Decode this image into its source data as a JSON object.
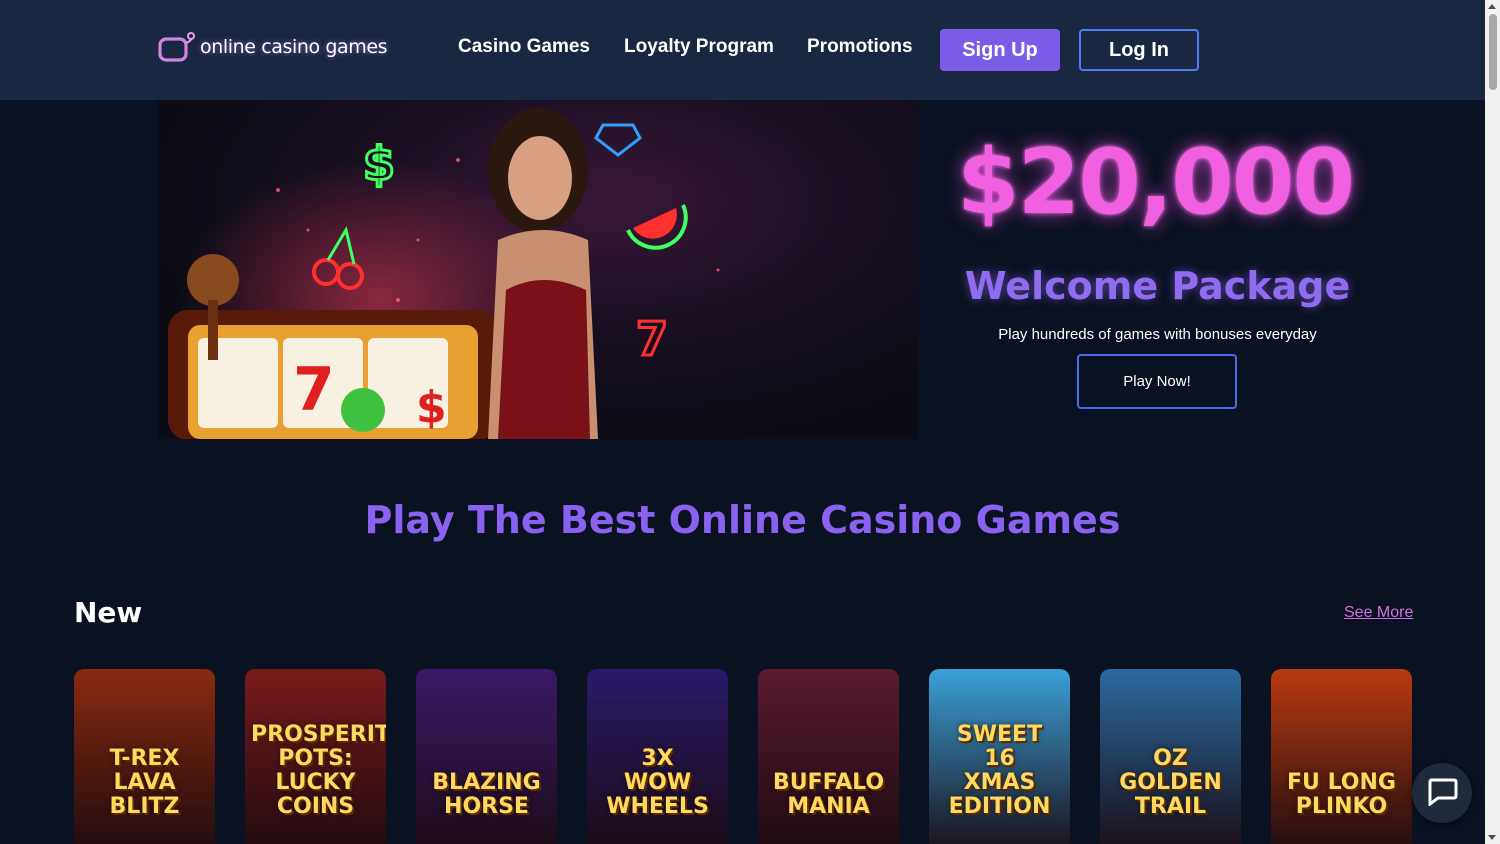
{
  "header": {
    "logo_text": "online casino games",
    "nav": [
      "Casino Games",
      "Loyalty Program",
      "Promotions"
    ],
    "signup_label": "Sign Up",
    "login_label": "Log In"
  },
  "hero": {
    "amount": "$20,000",
    "subtitle": "Welcome Package",
    "description": "Play hundreds of games with bonuses everyday",
    "cta_label": "Play Now!"
  },
  "section_title": "Play The Best Online Casino Games",
  "new_section": {
    "label": "New",
    "see_more": "See More",
    "games": [
      {
        "name": "T-REX\nLAVA BLITZ",
        "bg": "#8a2a10"
      },
      {
        "name": "PROSPERITY\nPOTS:\nLUCKY COINS",
        "bg": "#7a1a1a"
      },
      {
        "name": "BLAZING HORSE",
        "bg": "#3a1a6a"
      },
      {
        "name": "3X\nWOW\nWHEELS",
        "bg": "#2a1a6a"
      },
      {
        "name": "BUFFALO\nMANIA",
        "bg": "#5a1a30"
      },
      {
        "name": "SWEET\n16\nXMAS EDITION",
        "bg": "#3aa0d8"
      },
      {
        "name": "OZ\nGOLDEN TRAIL",
        "bg": "#2a6aa0"
      },
      {
        "name": "FU LONG\nPLINKO",
        "bg": "#b83a10"
      }
    ]
  },
  "colors": {
    "header_bg": "#1a2740",
    "page_bg": "#0a1120",
    "accent_purple": "#7b5ce6",
    "accent_pink": "#f060e0",
    "accent_blue": "#4a7cf6"
  }
}
